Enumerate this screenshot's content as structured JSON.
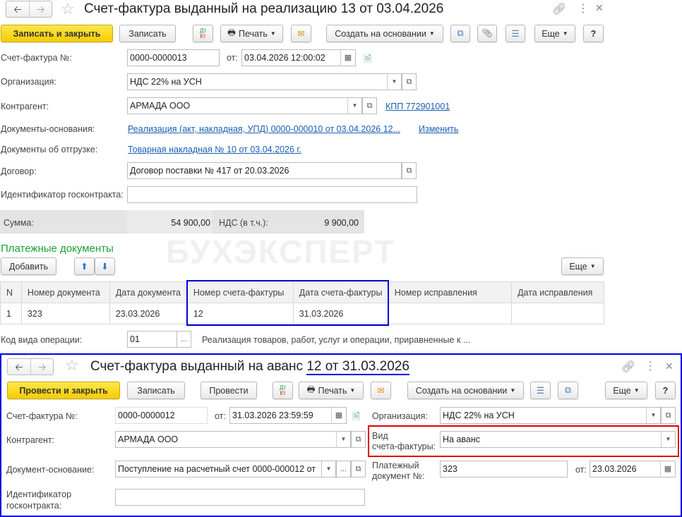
{
  "top": {
    "title": "Счет-фактура выданный на реализацию 13 от 03.04.2026",
    "toolbar": {
      "save_close": "Записать и закрыть",
      "save": "Записать",
      "dtkt_top": "Дт",
      "dtkt_bottom": "Кт",
      "print": "Печать",
      "create_based": "Создать на основании",
      "more": "Еще",
      "help": "?"
    },
    "invoice_label": "Счет-фактура №:",
    "invoice_number": "0000-0000013",
    "from_label": "от:",
    "invoice_date": "03.04.2026 12:00:02",
    "org_label": "Организация:",
    "org_value": "НДС 22% на УСН",
    "counterparty_label": "Контрагент:",
    "counterparty_value": "АРМАДА ООО",
    "kpp_link": "КПП 772901001",
    "base_docs_label": "Документы-основания:",
    "base_docs_link": "Реализация (акт, накладная, УПД) 0000-000010 от 03.04.2026 12...",
    "change_link": "Изменить",
    "shipment_label": "Документы об отгрузке:",
    "shipment_link": "Товарная накладная № 10 от 03.04.2026 г.",
    "contract_label": "Договор:",
    "contract_value": "Договор поставки № 417 от 20.03.2026",
    "gov_id_label": "Идентификатор госконтракта:",
    "gov_id_value": "",
    "sum_label": "Сумма:",
    "sum_value": "54 900,00",
    "vat_label": "НДС (в т.ч.):",
    "vat_value": "9 900,00",
    "payments_title": "Платежные документы",
    "add_button": "Добавить",
    "more": "Еще",
    "table": {
      "headers": [
        "N",
        "Номер документа",
        "Дата документа",
        "Номер счета-фактуры",
        "Дата счета-фактуры",
        "Номер исправления",
        "Дата исправления"
      ],
      "rows": [
        [
          "1",
          "323",
          "23.03.2026",
          "12",
          "31.03.2026",
          "",
          ""
        ]
      ]
    },
    "op_code_label": "Код вида операции:",
    "op_code_value": "01",
    "op_code_desc": "Реализация товаров, работ, услуг и операции, приравненные к ..."
  },
  "watermark": "БУХЭКСПЕРТ",
  "bottom": {
    "title_prefix": "Счет-фактура выданный на аванс ",
    "title_suffix": "12 от 31.03.2026",
    "toolbar": {
      "post_close": "Провести и закрыть",
      "save": "Записать",
      "post": "Провести",
      "print": "Печать",
      "create_based": "Создать на основании",
      "more": "Еще",
      "help": "?"
    },
    "invoice_label": "Счет-фактура №:",
    "invoice_number": "0000-0000012",
    "from_label": "от:",
    "invoice_date": "31.03.2026 23:59:59",
    "org_label": "Организация:",
    "org_value": "НДС 22% на УСН",
    "counterparty_label": "Контрагент:",
    "counterparty_value": "АРМАДА ООО",
    "type_label_1": "Вид",
    "type_label_2": "счета-фактуры:",
    "type_value": "На аванс",
    "base_doc_label": "Документ-основание:",
    "base_doc_value": "Поступление на расчетный счет 0000-000012 от",
    "pay_doc_label_1": "Платежный",
    "pay_doc_label_2": "документ №:",
    "pay_doc_value": "323",
    "pay_from_label": "от:",
    "pay_date": "23.03.2026",
    "gov_id_label_1": "Идентификатор",
    "gov_id_label_2": "госконтракта:",
    "gov_id_value": ""
  },
  "colors": {
    "accent_yellow": "#f5cc00",
    "highlight_blue": "#0000e0",
    "highlight_red": "#e00000",
    "green_title": "#1aa036",
    "link": "#1a5fb4"
  }
}
